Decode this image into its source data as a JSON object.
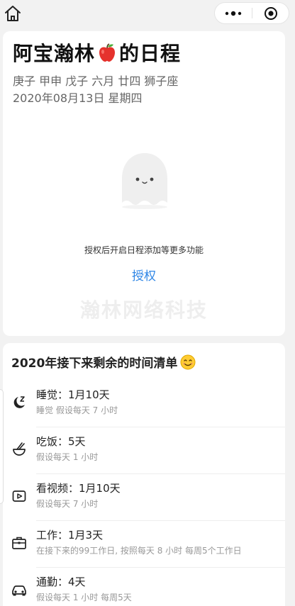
{
  "header": {
    "title_prefix": "阿宝瀚林",
    "title_suffix": "的日程",
    "lunar": "庚子 甲申 戊子 六月 廿四 狮子座",
    "date": "2020年08月13日 星期四"
  },
  "empty_state": {
    "hint": "授权后开启日程添加等更多功能",
    "auth_label": "授权",
    "watermark": "瀚林网络科技"
  },
  "remaining": {
    "title": "2020年接下来剩余的时间清单",
    "items": [
      {
        "name": "睡觉：1月10天",
        "desc": "睡觉 假设每天 7 小时",
        "icon": "moon-sleep-icon"
      },
      {
        "name": "吃饭：5天",
        "desc": "假设每天 1 小时",
        "icon": "bowl-icon"
      },
      {
        "name": "看视频：1月10天",
        "desc": "假设每天 7 小时",
        "icon": "video-play-icon"
      },
      {
        "name": "工作：1月3天",
        "desc": "在接下来的99工作日, 按照每天 8 小时 每周5个工作日",
        "icon": "briefcase-icon"
      },
      {
        "name": "通勤：4天",
        "desc": "假设每天 1 小时 每周5天",
        "icon": "car-icon"
      }
    ]
  },
  "colors": {
    "accent": "#2f86e6",
    "background": "#f2f2f2",
    "card": "#ffffff"
  }
}
